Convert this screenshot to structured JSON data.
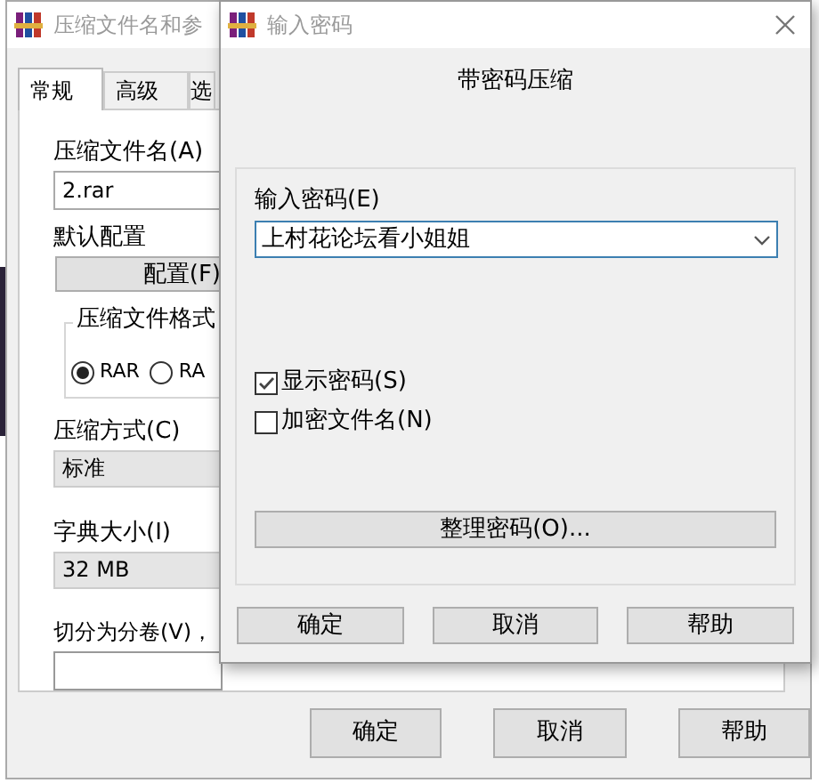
{
  "background_window": {
    "title": "压缩文件名和参",
    "tabs": [
      {
        "label": "常规",
        "selected": true
      },
      {
        "label": "高级",
        "selected": false
      },
      {
        "label": "选",
        "selected": false
      }
    ],
    "archive_name": {
      "label": "压缩文件名(A)",
      "value": "2.rar"
    },
    "profiles": {
      "label": "默认配置",
      "button": "配置(F)"
    },
    "archive_format": {
      "label": "压缩文件格式",
      "options": [
        {
          "label": "RAR",
          "selected": true
        },
        {
          "label": "RA",
          "selected": false
        }
      ]
    },
    "compression_method": {
      "label": "压缩方式(C)",
      "value": "标准"
    },
    "dictionary_size": {
      "label": "字典大小(I)",
      "value": "32 MB"
    },
    "split_volumes": {
      "label": "切分为分卷(V)，"
    },
    "buttons": [
      "确定",
      "取消",
      "帮助"
    ]
  },
  "password_dialog": {
    "title": "输入密码",
    "heading": "带密码压缩",
    "password": {
      "label": "输入密码(E)",
      "value": "上村花论坛看小姐姐"
    },
    "options": [
      {
        "label": "显示密码(S)",
        "checked": true
      },
      {
        "label": "加密文件名(N)",
        "checked": false
      }
    ],
    "organize_button": "整理密码(O)...",
    "buttons": [
      "确定",
      "取消",
      "帮助"
    ]
  }
}
